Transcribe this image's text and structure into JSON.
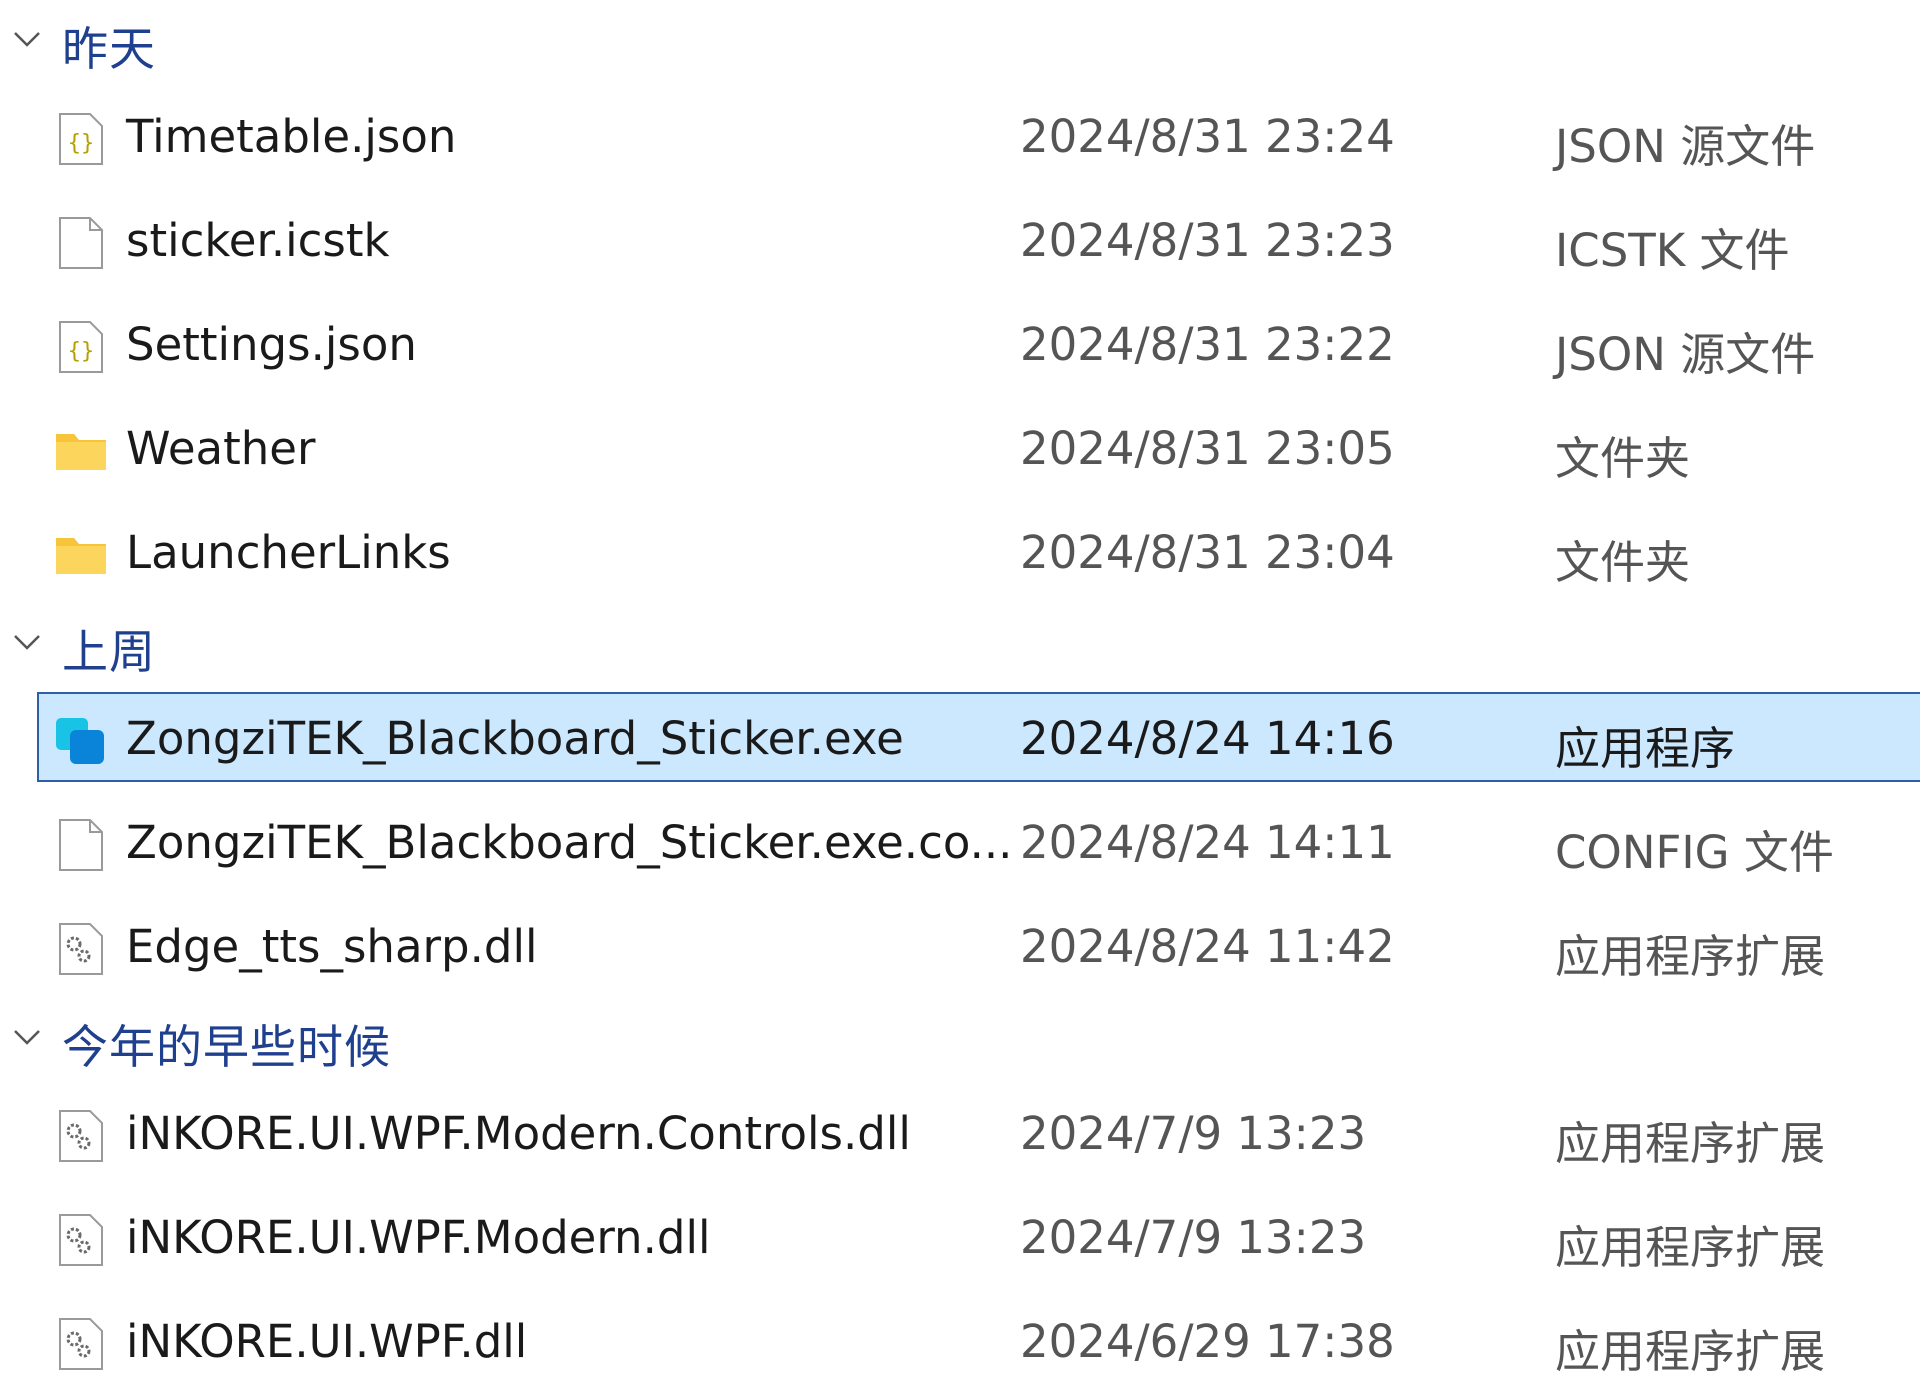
{
  "groups": [
    {
      "title": "昨天",
      "files": [
        {
          "name": "Timetable.json",
          "date": "2024/8/31 23:24",
          "type": "JSON 源文件",
          "icon": "json-file-icon"
        },
        {
          "name": "sticker.icstk",
          "date": "2024/8/31 23:23",
          "type": "ICSTK 文件",
          "icon": "file-icon"
        },
        {
          "name": "Settings.json",
          "date": "2024/8/31 23:22",
          "type": "JSON 源文件",
          "icon": "json-file-icon"
        },
        {
          "name": "Weather",
          "date": "2024/8/31 23:05",
          "type": "文件夹",
          "icon": "folder-icon"
        },
        {
          "name": "LauncherLinks",
          "date": "2024/8/31 23:04",
          "type": "文件夹",
          "icon": "folder-icon"
        }
      ]
    },
    {
      "title": "上周",
      "files": [
        {
          "name": "ZongziTEK_Blackboard_Sticker.exe",
          "date": "2024/8/24 14:16",
          "type": "应用程序",
          "icon": "app-icon",
          "selected": true
        },
        {
          "name": "ZongziTEK_Blackboard_Sticker.exe.co...",
          "date": "2024/8/24 14:11",
          "type": "CONFIG 文件",
          "icon": "file-icon"
        },
        {
          "name": "Edge_tts_sharp.dll",
          "date": "2024/8/24 11:42",
          "type": "应用程序扩展",
          "icon": "dll-file-icon"
        }
      ]
    },
    {
      "title": "今年的早些时候",
      "files": [
        {
          "name": "iNKORE.UI.WPF.Modern.Controls.dll",
          "date": "2024/7/9 13:23",
          "type": "应用程序扩展",
          "icon": "dll-file-icon"
        },
        {
          "name": "iNKORE.UI.WPF.Modern.dll",
          "date": "2024/7/9 13:23",
          "type": "应用程序扩展",
          "icon": "dll-file-icon"
        },
        {
          "name": "iNKORE.UI.WPF.dll",
          "date": "2024/6/29 17:38",
          "type": "应用程序扩展",
          "icon": "dll-file-icon"
        }
      ]
    }
  ],
  "colors": {
    "group_title": "#1f3f8f",
    "selection_bg": "#cce8ff",
    "selection_border": "#2b5fa8",
    "folder": "#f8c43a"
  }
}
